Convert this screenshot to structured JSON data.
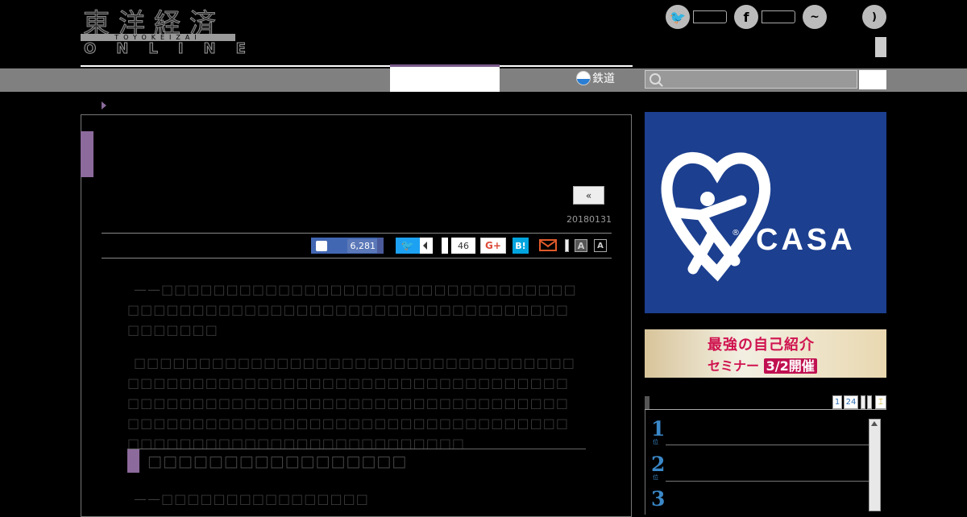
{
  "logo": {
    "kanji": "東洋経済",
    "roman": "TOYOKEIZAI",
    "online": "ONLINE"
  },
  "nav": {
    "rail_label": "鉄道",
    "search_placeholder": ""
  },
  "article": {
    "prev_label": "«",
    "date": "20180131",
    "share": {
      "like_count": "6,281",
      "twitter_glyph": "🐦",
      "comment_count": "46",
      "gplus_label": "G+",
      "hatena_label": "B!"
    },
    "font_size_large": "A",
    "font_size_small": "A",
    "paragraphs": [
      "——□□□□□□□□□□□□□□□□□□□□□□□□□□□□□□□□□□□□□□□□□□□□□□□□□□□□□□□□□□□□□□□□□□□□□□□□□",
      "□□□□□□□□□□□□□□□□□□□□□□□□□□□□□□□□□□□□□□□□□□□□□□□□□□□□□□□□□□□□□□□□□□□□□□□□□□□□□□□□□□□□□□□□□□□□□□□□□□□□□□□□□□□□□□□□□□□□□□□□□□□□□□□□□□□□□□□□□□□□□□□□□□□□□□□□□□□□□□□□□□"
    ],
    "h2": "□□□□□□□□□□□□□□□□□",
    "para3": "——□□□□□□□□□□□□□□□□"
  },
  "sidebar": {
    "casa": "CASA",
    "casa_reg": "®",
    "banner_line1": "最強の自己紹介",
    "banner_line2": "セミナー",
    "banner_date": "3/2開催",
    "pager": [
      "1",
      "24"
    ],
    "ranks": [
      "1",
      "2",
      "3"
    ],
    "rank_suffix": "位"
  },
  "colors": {
    "accent": "#8c6a9c",
    "casa_blue": "#1c3f8f",
    "facebook": "#4267b2",
    "twitter": "#1da1f2",
    "hatena": "#00a4de"
  }
}
